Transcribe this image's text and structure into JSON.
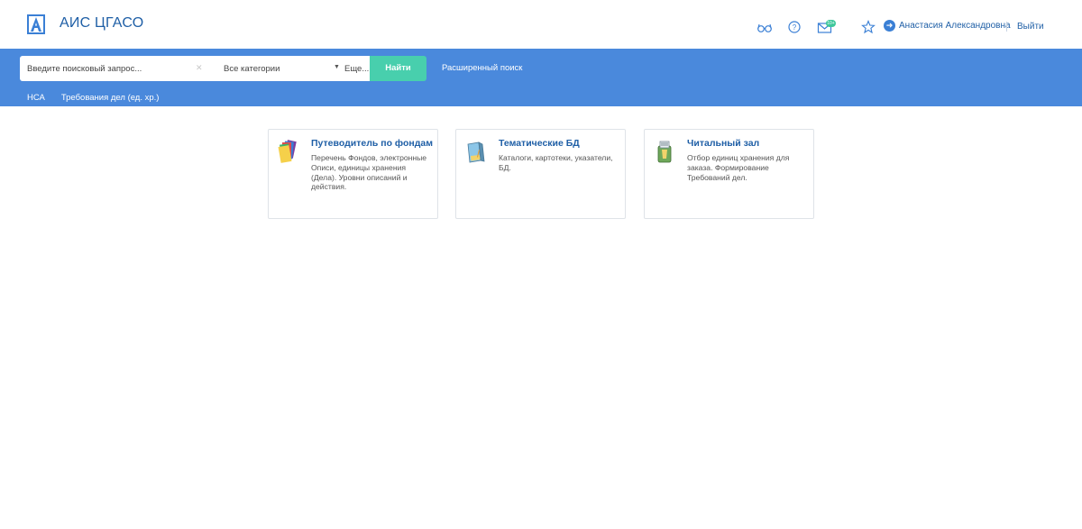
{
  "header": {
    "app_title": "АИС ЦГАСО",
    "logo_icon": "archive-logo-icon",
    "icons": [
      "glasses-icon",
      "help-icon",
      "mail-icon",
      "star-icon"
    ],
    "mail_badge": "10+",
    "user_name": "Анастасия Александровна",
    "logout_label": "Выйти"
  },
  "search": {
    "placeholder": "Введите поисковый запрос...",
    "category": "Все категории",
    "more_label": "Еще...",
    "find_label": "Найти",
    "advanced_label": "Расширенный поиск"
  },
  "subnav": {
    "items": [
      {
        "label": "НСА"
      },
      {
        "label": "Требования дел (ед. хр.)"
      }
    ]
  },
  "cards": [
    {
      "title": "Путеводитель по фондам",
      "desc": "Перечень Фондов, электронные Описи, единицы хранения (Дела). Уровни описаний и действия.",
      "icon": "folders-icon"
    },
    {
      "title": "Тематические БД",
      "desc": "Каталоги, картотеки, указатели, БД.",
      "icon": "book-icon"
    },
    {
      "title": "Читальный зал",
      "desc": "Отбор единиц хранения для заказа. Формирование Требований дел.",
      "icon": "reading-room-icon"
    }
  ],
  "colors": {
    "band": "#4a89dc",
    "accent_green": "#48cfad",
    "link_blue": "#1f5fa6"
  }
}
